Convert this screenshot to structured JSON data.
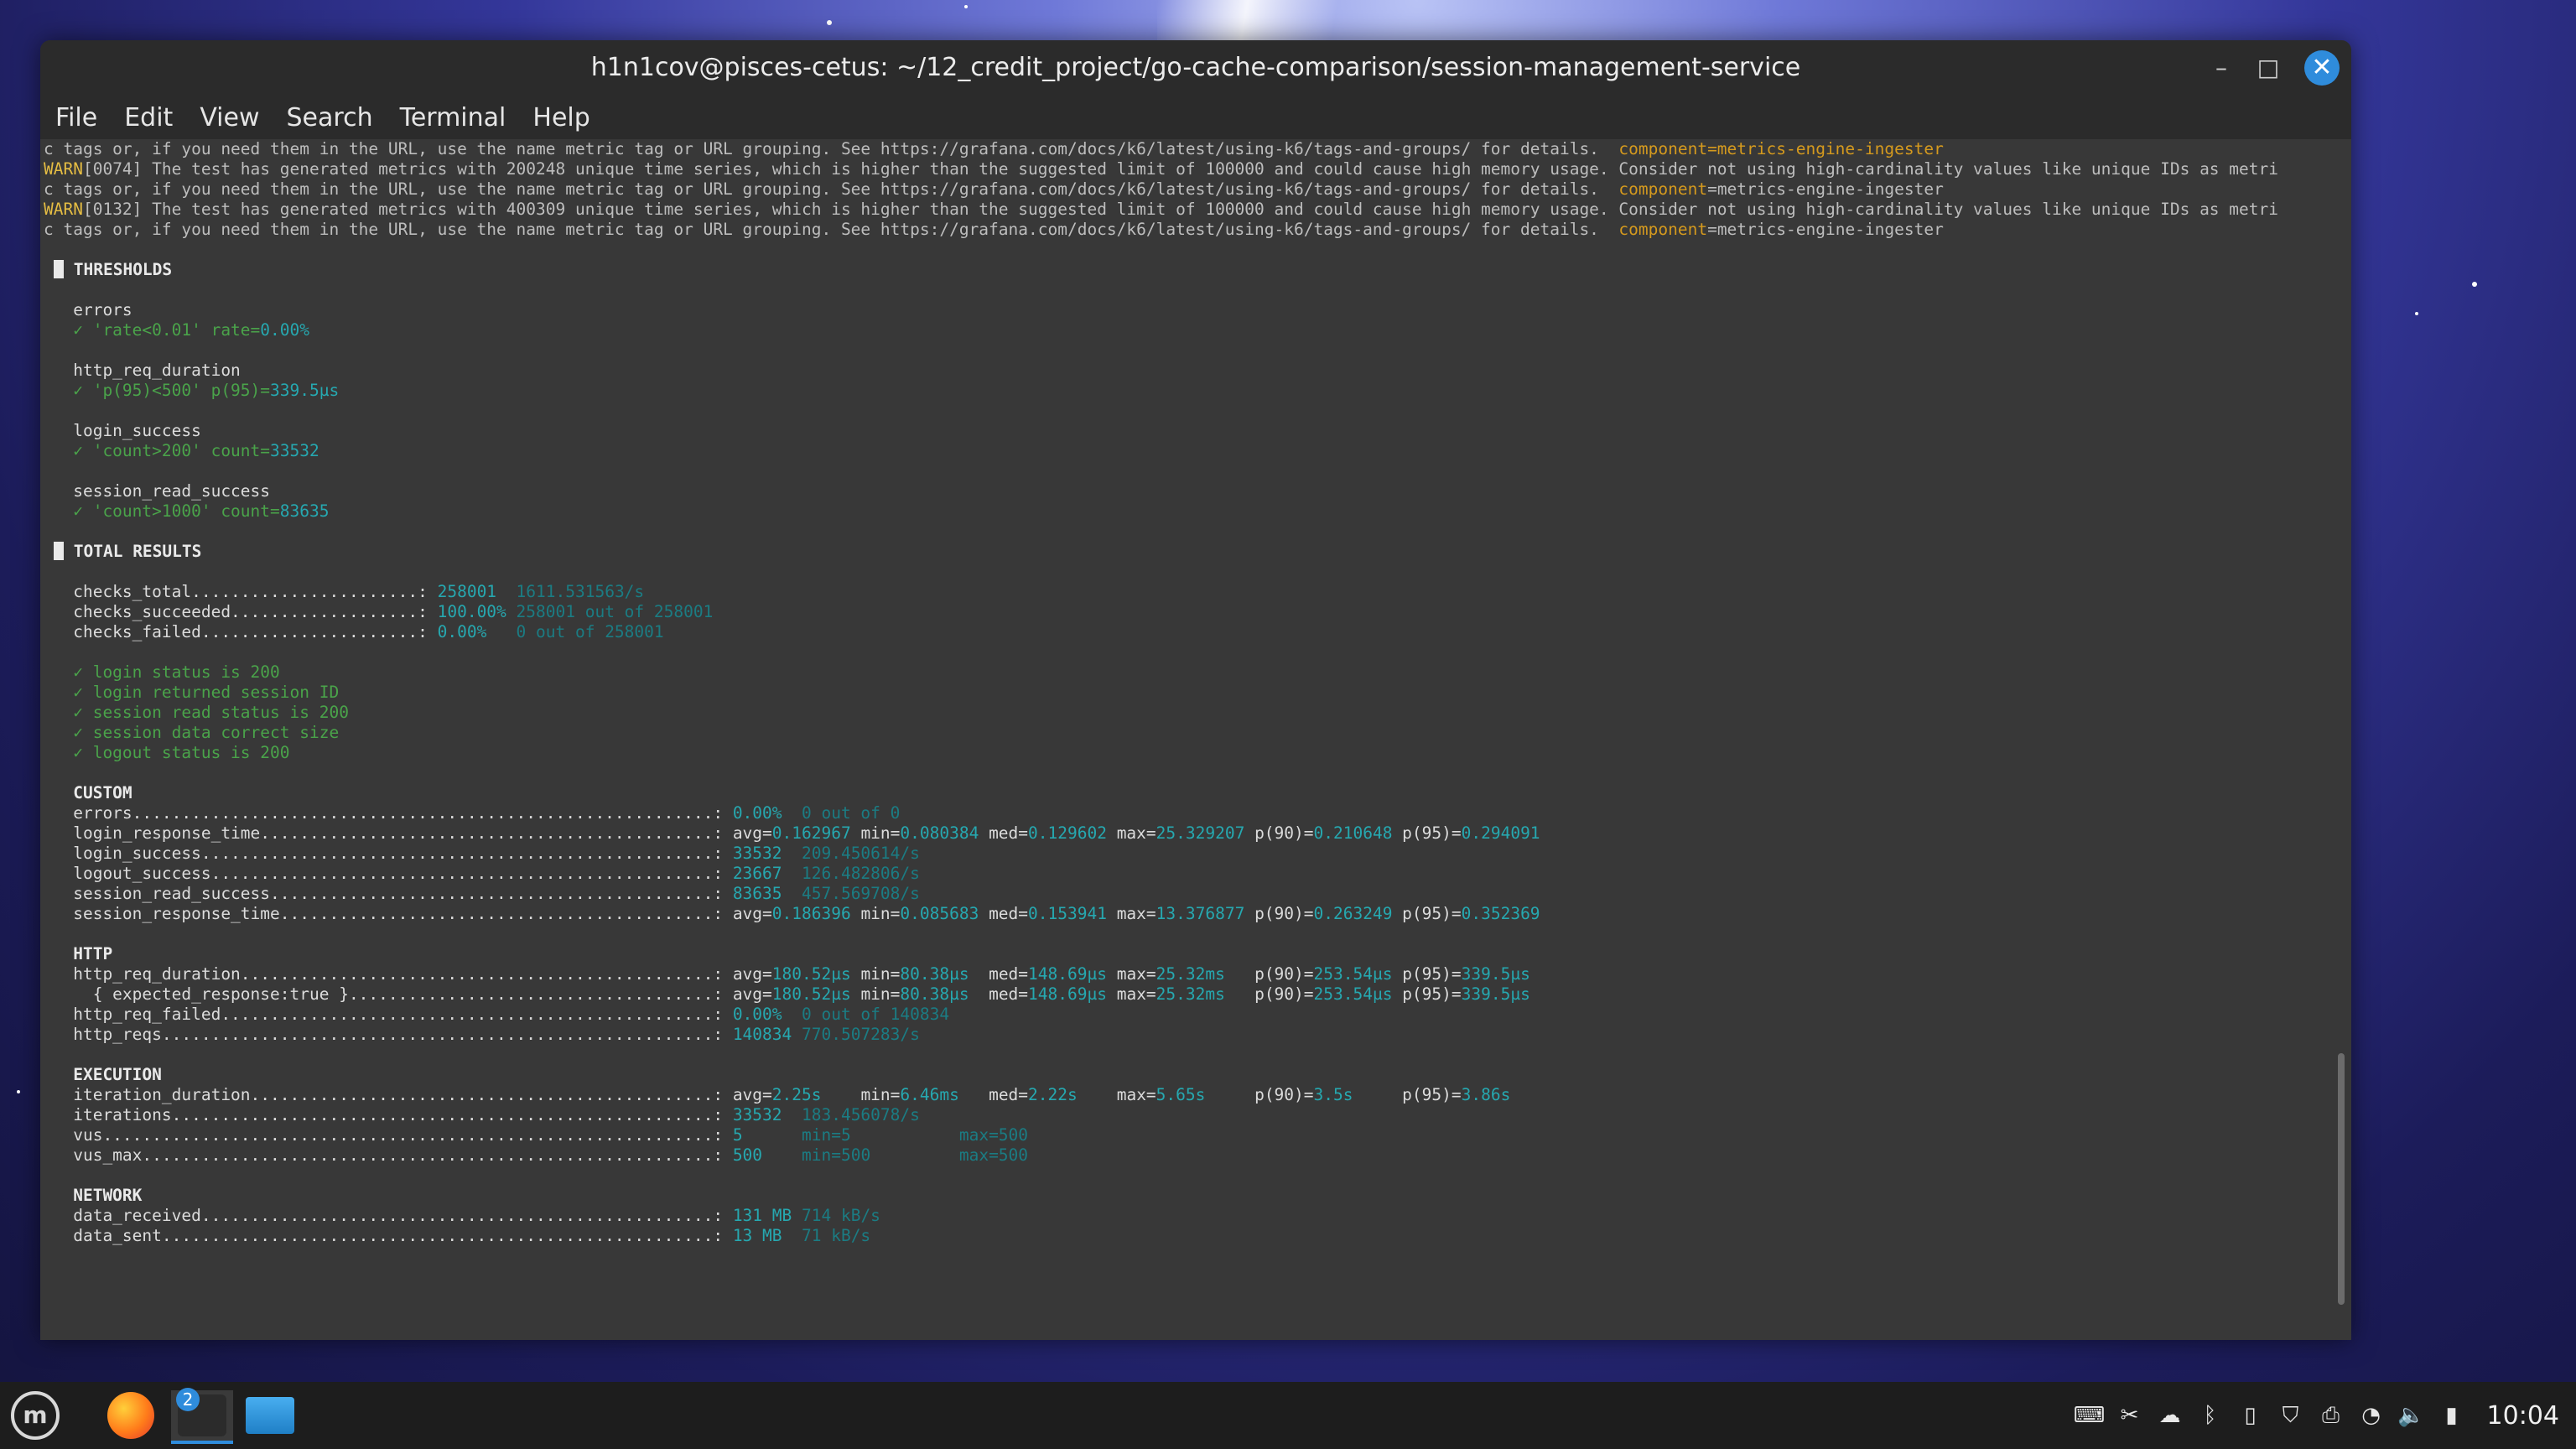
{
  "window": {
    "title": "h1n1cov@pisces-cetus: ~/12_credit_project/go-cache-comparison/session-management-service",
    "controls": {
      "minimize": "–",
      "maximize": "□",
      "close": "✕"
    }
  },
  "menu": [
    "File",
    "Edit",
    "View",
    "Search",
    "Terminal",
    "Help"
  ],
  "terminal": {
    "warn_top_partial": "c tags or, if you need them in the URL, use the name metric tag or URL grouping. See https://grafana.com/docs/k6/latest/using-k6/tags-and-groups/ for details.",
    "warn_top_partial_comp": "component=metrics-engine-ingester",
    "warnings": [
      {
        "tag": "WARN",
        "text1": "[0074] The test has generated metrics with 200248 unique time series, which is higher than the suggested limit of 100000 and could cause high memory usage. Consider not using high-cardinality values like unique IDs as metri",
        "text2": "c tags or, if you need them in the URL, use the name metric tag or URL grouping. See https://grafana.com/docs/k6/latest/using-k6/tags-and-groups/ for details.  ",
        "comp_key": "component",
        "comp_val": "=metrics-engine-ingester"
      },
      {
        "tag": "WARN",
        "text1": "[0132] The test has generated metrics with 400309 unique time series, which is higher than the suggested limit of 100000 and could cause high memory usage. Consider not using high-cardinality values like unique IDs as metri",
        "text2": "c tags or, if you need them in the URL, use the name metric tag or URL grouping. See https://grafana.com/docs/k6/latest/using-k6/tags-and-groups/ for details.  ",
        "comp_key": "component",
        "comp_val": "=metrics-engine-ingester"
      }
    ],
    "thresholds_header": "THRESHOLDS",
    "thresholds": [
      {
        "name": "errors",
        "check": "✓ 'rate<0.01' rate=",
        "value": "0.00%"
      },
      {
        "name": "http_req_duration",
        "check": "✓ 'p(95)<500' p(95)=",
        "value": "339.5µs"
      },
      {
        "name": "login_success",
        "check": "✓ 'count>200' count=",
        "value": "33532"
      },
      {
        "name": "session_read_success",
        "check": "✓ 'count>1000' count=",
        "value": "83635"
      }
    ],
    "total_header": "TOTAL RESULTS",
    "checks": [
      {
        "label": "checks_total.......................: ",
        "value": "258001",
        "extra": "  1611.531563/s"
      },
      {
        "label": "checks_succeeded...................: ",
        "value": "100.00%",
        "extra": " 258001 out of 258001"
      },
      {
        "label": "checks_failed......................: ",
        "value": "0.00%",
        "extra": "   0 out of 258001"
      }
    ],
    "check_items": [
      "✓ login status is 200",
      "✓ login returned session ID",
      "✓ session read status is 200",
      "✓ session data correct size",
      "✓ logout status is 200"
    ],
    "custom_header": "CUSTOM",
    "custom": [
      {
        "label": "errors...........................................................: ",
        "parts": [
          [
            "0.00%",
            "teal"
          ],
          [
            "  0 out of 0",
            "dim"
          ]
        ]
      },
      {
        "label": "login_response_time..............................................: ",
        "parts": [
          [
            "avg=",
            "plain"
          ],
          [
            "0.162967",
            "teal"
          ],
          [
            " min=",
            "plain"
          ],
          [
            "0.080384",
            "teal"
          ],
          [
            " med=",
            "plain"
          ],
          [
            "0.129602",
            "teal"
          ],
          [
            " max=",
            "plain"
          ],
          [
            "25.329207",
            "teal"
          ],
          [
            " p(90)=",
            "plain"
          ],
          [
            "0.210648",
            "teal"
          ],
          [
            " p(95)=",
            "plain"
          ],
          [
            "0.294091",
            "teal"
          ]
        ]
      },
      {
        "label": "login_success....................................................: ",
        "parts": [
          [
            "33532",
            "teal"
          ],
          [
            "  209.450614/s",
            "dim"
          ]
        ]
      },
      {
        "label": "logout_success...................................................: ",
        "parts": [
          [
            "23667",
            "teal"
          ],
          [
            "  126.482806/s",
            "dim"
          ]
        ]
      },
      {
        "label": "session_read_success.............................................: ",
        "parts": [
          [
            "83635",
            "teal"
          ],
          [
            "  457.569708/s",
            "dim"
          ]
        ]
      },
      {
        "label": "session_response_time............................................: ",
        "parts": [
          [
            "avg=",
            "plain"
          ],
          [
            "0.186396",
            "teal"
          ],
          [
            " min=",
            "plain"
          ],
          [
            "0.085683",
            "teal"
          ],
          [
            " med=",
            "plain"
          ],
          [
            "0.153941",
            "teal"
          ],
          [
            " max=",
            "plain"
          ],
          [
            "13.376877",
            "teal"
          ],
          [
            " p(90)=",
            "plain"
          ],
          [
            "0.263249",
            "teal"
          ],
          [
            " p(95)=",
            "plain"
          ],
          [
            "0.352369",
            "teal"
          ]
        ]
      }
    ],
    "http_header": "HTTP",
    "http": [
      {
        "label": "http_req_duration................................................: ",
        "parts": [
          [
            "avg=",
            "plain"
          ],
          [
            "180.52µs",
            "teal"
          ],
          [
            " min=",
            "plain"
          ],
          [
            "80.38µs",
            "teal"
          ],
          [
            "  med=",
            "plain"
          ],
          [
            "148.69µs",
            "teal"
          ],
          [
            " max=",
            "plain"
          ],
          [
            "25.32ms",
            "teal"
          ],
          [
            "   p(90)=",
            "plain"
          ],
          [
            "253.54µs",
            "teal"
          ],
          [
            " p(95)=",
            "plain"
          ],
          [
            "339.5µs",
            "teal"
          ]
        ]
      },
      {
        "label": "  { expected_response:true }.....................................: ",
        "parts": [
          [
            "avg=",
            "plain"
          ],
          [
            "180.52µs",
            "teal"
          ],
          [
            " min=",
            "plain"
          ],
          [
            "80.38µs",
            "teal"
          ],
          [
            "  med=",
            "plain"
          ],
          [
            "148.69µs",
            "teal"
          ],
          [
            " max=",
            "plain"
          ],
          [
            "25.32ms",
            "teal"
          ],
          [
            "   p(90)=",
            "plain"
          ],
          [
            "253.54µs",
            "teal"
          ],
          [
            " p(95)=",
            "plain"
          ],
          [
            "339.5µs",
            "teal"
          ]
        ]
      },
      {
        "label": "http_req_failed..................................................: ",
        "parts": [
          [
            "0.00%",
            "teal"
          ],
          [
            "  0 out of 140834",
            "dim"
          ]
        ]
      },
      {
        "label": "http_reqs........................................................: ",
        "parts": [
          [
            "140834",
            "teal"
          ],
          [
            " 770.507283/s",
            "dim"
          ]
        ]
      }
    ],
    "exec_header": "EXECUTION",
    "execution": [
      {
        "label": "iteration_duration...............................................: ",
        "parts": [
          [
            "avg=",
            "plain"
          ],
          [
            "2.25s",
            "teal"
          ],
          [
            "    min=",
            "plain"
          ],
          [
            "6.46ms",
            "teal"
          ],
          [
            "   med=",
            "plain"
          ],
          [
            "2.22s",
            "teal"
          ],
          [
            "    max=",
            "plain"
          ],
          [
            "5.65s",
            "teal"
          ],
          [
            "     p(90)=",
            "plain"
          ],
          [
            "3.5s",
            "teal"
          ],
          [
            "     p(95)=",
            "plain"
          ],
          [
            "3.86s",
            "teal"
          ]
        ]
      },
      {
        "label": "iterations.......................................................: ",
        "parts": [
          [
            "33532",
            "teal"
          ],
          [
            "  183.456078/s",
            "dim"
          ]
        ]
      },
      {
        "label": "vus..............................................................: ",
        "parts": [
          [
            "5",
            "teal"
          ],
          [
            "      min=5",
            "dim"
          ],
          [
            "           max=500",
            "dim"
          ]
        ]
      },
      {
        "label": "vus_max..........................................................: ",
        "parts": [
          [
            "500",
            "teal"
          ],
          [
            "    min=500",
            "dim"
          ],
          [
            "         max=500",
            "dim"
          ]
        ]
      }
    ],
    "net_header": "NETWORK",
    "network": [
      {
        "label": "data_received....................................................: ",
        "parts": [
          [
            "131 MB",
            "teal"
          ],
          [
            " 714 kB/s",
            "dim"
          ]
        ]
      },
      {
        "label": "data_sent........................................................: ",
        "parts": [
          [
            "13 MB",
            "teal"
          ],
          [
            "  71 kB/s",
            "dim"
          ]
        ]
      }
    ]
  },
  "taskbar": {
    "menu_logo": "m",
    "terminal_badge": "2",
    "clock": "10:04",
    "tray_icons": [
      "keyboard-icon",
      "screenshot-icon",
      "cloud-icon",
      "bluetooth-icon",
      "clipboard-icon",
      "shield-icon",
      "printer-icon",
      "wifi-icon",
      "volume-icon",
      "battery-icon"
    ]
  }
}
